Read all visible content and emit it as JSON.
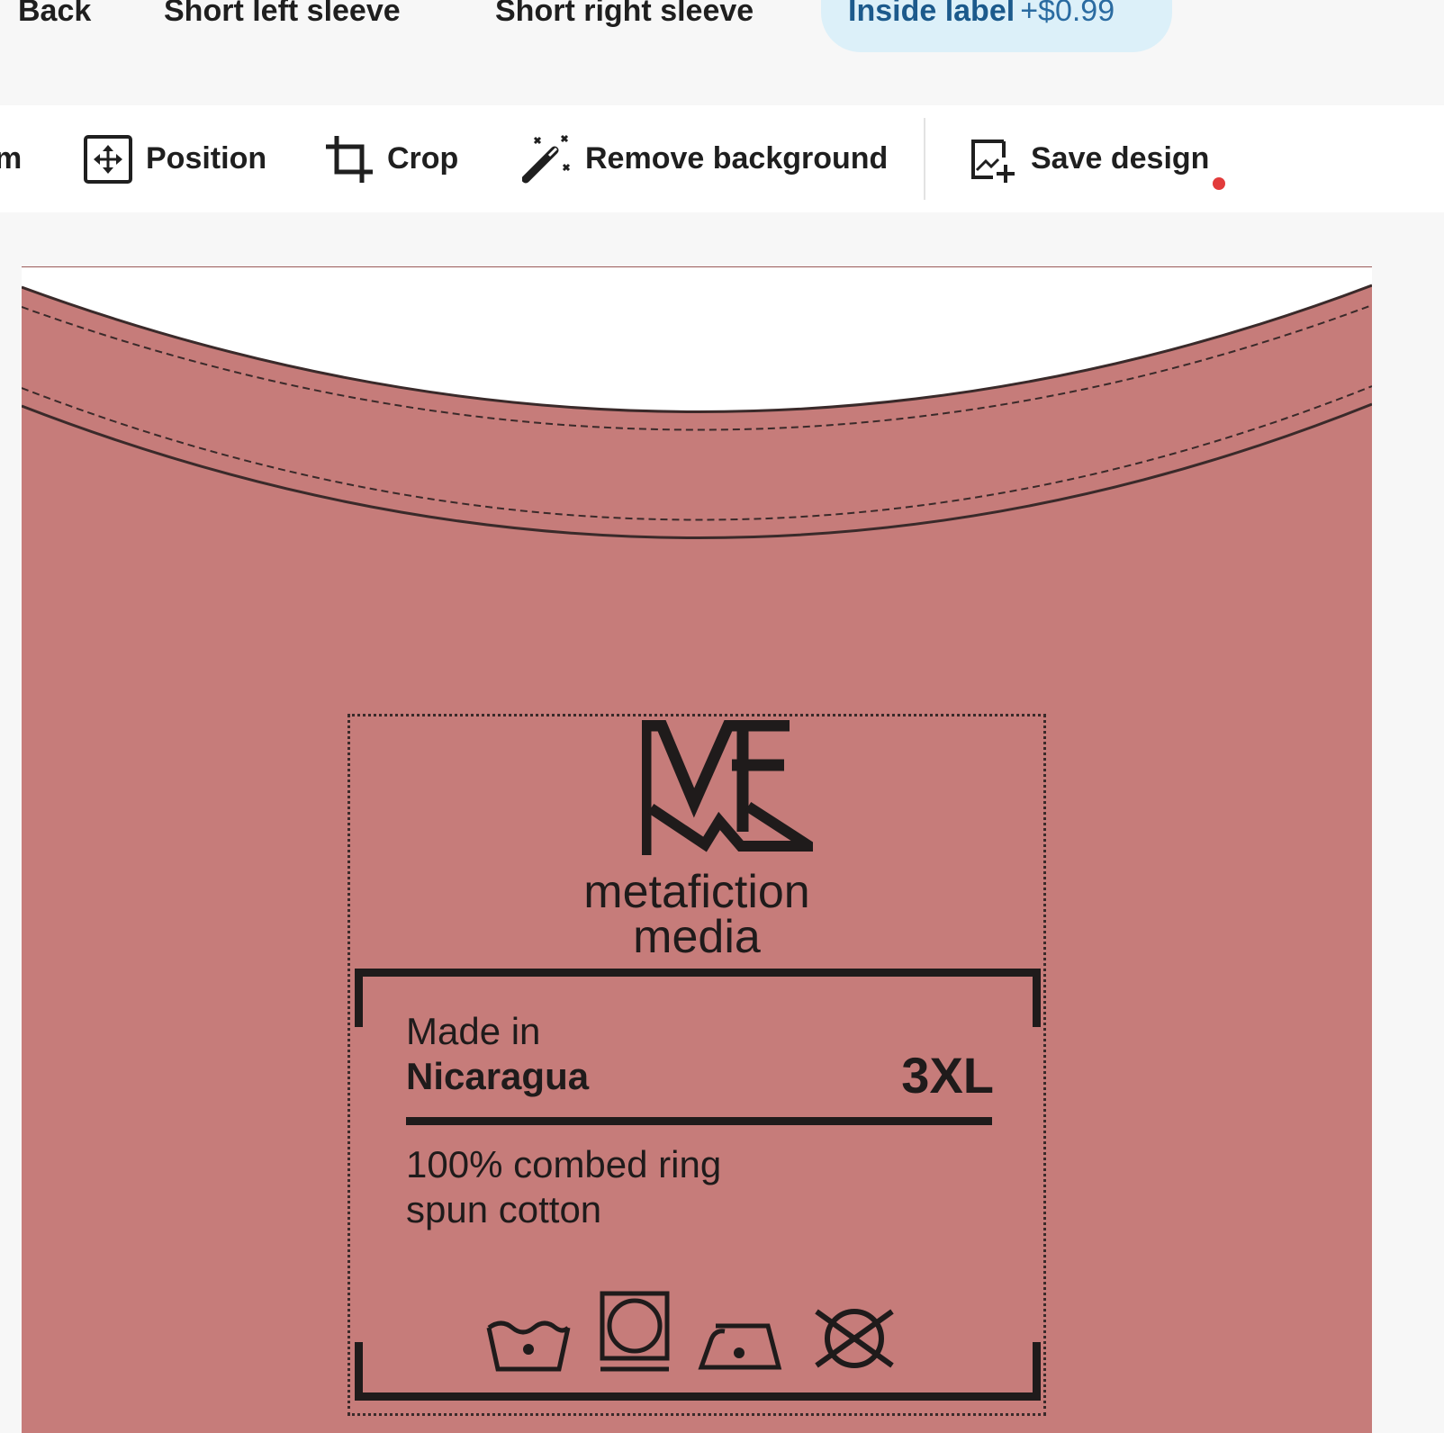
{
  "tabs": {
    "back": "Back",
    "short_left_sleeve": "Short left sleeve",
    "short_right_sleeve": "Short right sleeve",
    "inside_label": "Inside label",
    "inside_label_price": "+$0.99"
  },
  "toolbar": {
    "partial_label": "m",
    "position": "Position",
    "crop": "Crop",
    "remove_background": "Remove background",
    "save_design": "Save design"
  },
  "label": {
    "brand_line1": "metafiction",
    "brand_line2": "media",
    "made_in": "Made in",
    "country": "Nicaragua",
    "size": "3XL",
    "fabric_line1": "100% combed ring",
    "fabric_line2": "spun cotton",
    "logo_text": "ME",
    "care_icons": [
      "wash-30-icon",
      "tumble-dry-icon",
      "iron-low-icon",
      "do-not-dry-clean-icon"
    ]
  },
  "colors": {
    "garment": "#c67c7a",
    "active_tab_bg": "#dcf0f9",
    "active_tab_text": "#1c5a8c",
    "save_indicator": "#e23b3b"
  }
}
